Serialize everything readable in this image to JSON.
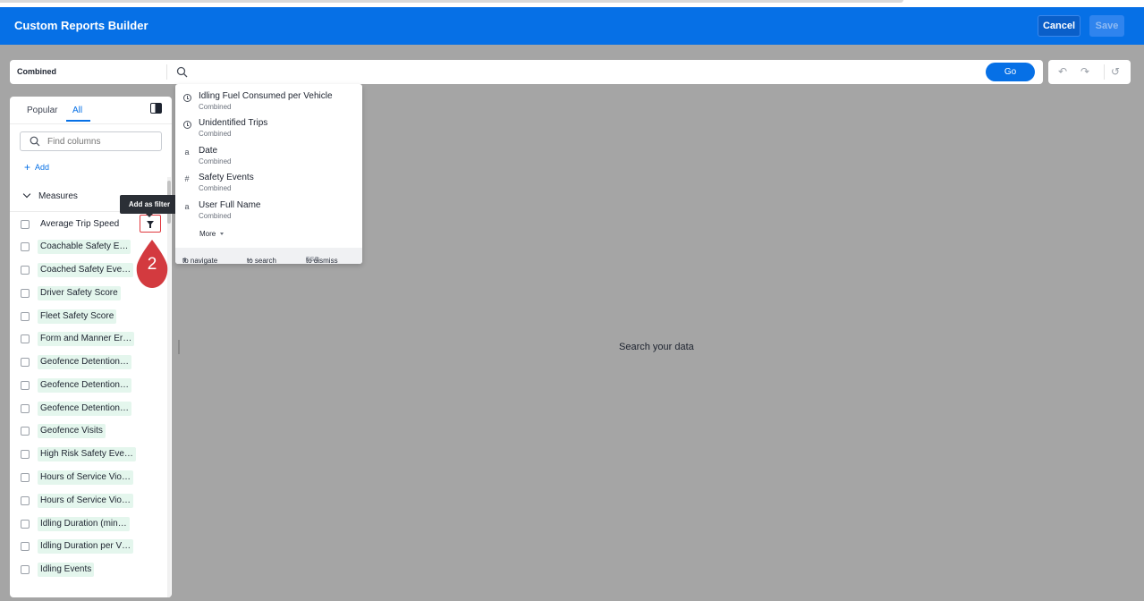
{
  "header": {
    "title": "Custom Reports Builder",
    "cancel_label": "Cancel",
    "save_label": "Save",
    "brand_color": "#0670e6"
  },
  "searchbar": {
    "source": "Combined",
    "go_label": "Go"
  },
  "panel": {
    "tabs": [
      {
        "label": "Popular",
        "active": false
      },
      {
        "label": "All",
        "active": true
      }
    ],
    "find_placeholder": "Find columns",
    "add_label": "Add",
    "section_title": "Measures",
    "tooltip": "Add as filter",
    "items": [
      {
        "label": "Average Trip Speed"
      },
      {
        "label": "Coachable Safety E…"
      },
      {
        "label": "Coached Safety Eve…"
      },
      {
        "label": "Driver Safety Score"
      },
      {
        "label": "Fleet Safety Score"
      },
      {
        "label": "Form and Manner Er…"
      },
      {
        "label": "Geofence Detention…"
      },
      {
        "label": "Geofence Detention…"
      },
      {
        "label": "Geofence Detention…"
      },
      {
        "label": "Geofence Visits"
      },
      {
        "label": "High Risk Safety Eve…"
      },
      {
        "label": "Hours of Service Vio…"
      },
      {
        "label": "Hours of Service Vio…"
      },
      {
        "label": "Idling Duration (min…"
      },
      {
        "label": "Idling Duration per V…"
      },
      {
        "label": "Idling Events"
      }
    ]
  },
  "callout": {
    "number": "2",
    "color": "#d33a3f"
  },
  "dropdown": {
    "items": [
      {
        "icon": "clock-icon",
        "name": "Idling Fuel Consumed per Vehicle",
        "sub": "Combined"
      },
      {
        "icon": "clock-icon",
        "name": "Unidentified Trips",
        "sub": "Combined"
      },
      {
        "icon": "text-icon",
        "glyph": "a",
        "name": "Date",
        "sub": "Combined"
      },
      {
        "icon": "number-icon",
        "glyph": "#",
        "name": "Safety Events",
        "sub": "Combined"
      },
      {
        "icon": "text-icon",
        "glyph": "a",
        "name": "User Full Name",
        "sub": "Combined"
      }
    ],
    "more_label": "More",
    "footer": {
      "navigate": "to navigate",
      "search": "to search",
      "dismiss_key": "ESC",
      "dismiss": "to dismiss"
    }
  },
  "main": {
    "empty_text": "Search your data"
  }
}
